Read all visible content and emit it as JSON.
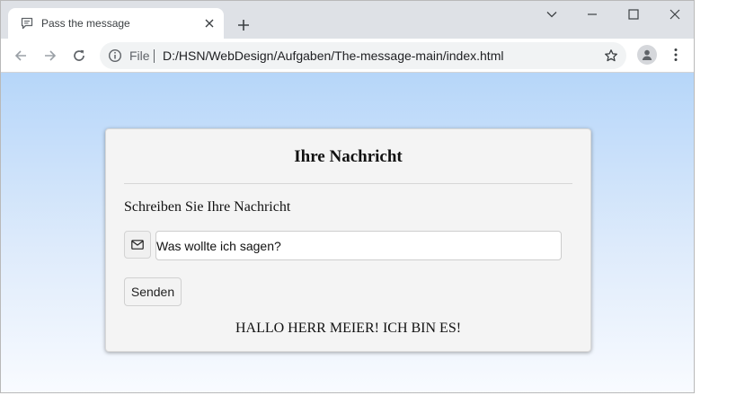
{
  "browser": {
    "tab_title": "Pass the message",
    "omnibox": {
      "scheme_label": "File",
      "url": "D:/HSN/WebDesign/Aufgaben/The-message-main/index.html"
    },
    "icons": [
      "chat-bubble-icon",
      "close-icon",
      "plus-icon",
      "chevron-down-icon",
      "minimize-icon",
      "maximize-icon",
      "close-window-icon",
      "back-arrow-icon",
      "forward-arrow-icon",
      "reload-icon",
      "info-icon",
      "star-icon",
      "profile-icon",
      "kebab-menu-icon"
    ]
  },
  "page": {
    "card_title": "Ihre Nachricht",
    "prompt": "Schreiben Sie Ihre Nachricht",
    "input_value": "Was wollte ich sagen?",
    "send_label": "Senden",
    "output_text": "HALLO HERR MEIER! ICH BIN ES!",
    "colors": {
      "gradient_top": "#b6d6f9",
      "gradient_bottom": "#f9fbff",
      "card_bg": "#f4f4f4"
    }
  }
}
